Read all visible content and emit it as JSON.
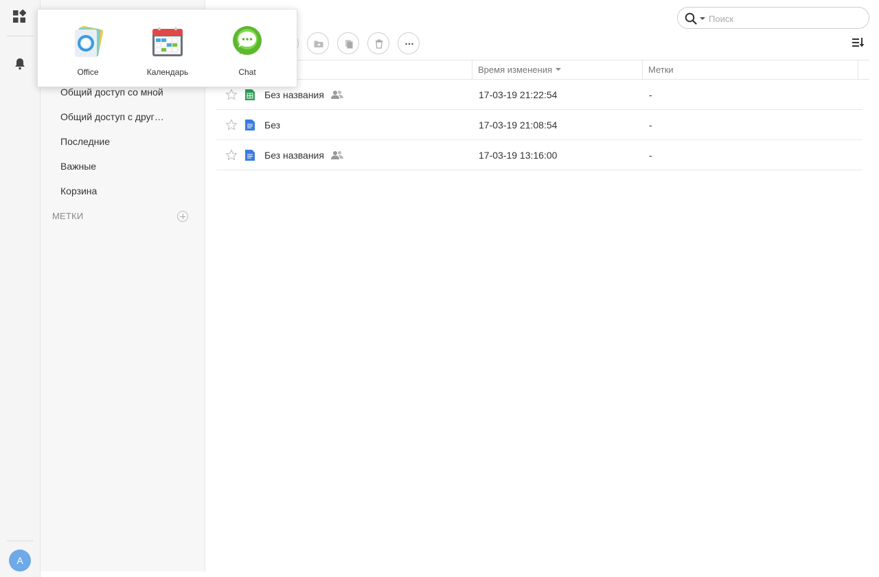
{
  "search": {
    "placeholder": "Поиск"
  },
  "rail": {
    "avatar_letter": "A"
  },
  "sidebar": {
    "items": [
      {
        "label": "Общий доступ со мной"
      },
      {
        "label": "Общий доступ с друг…"
      },
      {
        "label": "Последние"
      },
      {
        "label": "Важные"
      },
      {
        "label": "Корзина"
      }
    ],
    "tags_label": "МЕТКИ"
  },
  "table": {
    "columns": {
      "modified": "Время изменения",
      "tags": "Метки"
    },
    "rows": [
      {
        "name": "Без названия",
        "type": "spreadsheet",
        "shared": true,
        "modified": "17-03-19 21:22:54",
        "tags": "-"
      },
      {
        "name": "Без",
        "type": "document",
        "shared": false,
        "modified": "17-03-19 21:08:54",
        "tags": "-"
      },
      {
        "name": "Без названия",
        "type": "document",
        "shared": true,
        "modified": "17-03-19 13:16:00",
        "tags": "-"
      }
    ]
  },
  "launcher": {
    "apps": [
      {
        "label": "Office",
        "icon": "office-icon"
      },
      {
        "label": "Календарь",
        "icon": "calendar-icon"
      },
      {
        "label": "Chat",
        "icon": "chat-icon"
      }
    ]
  },
  "colors": {
    "spreadsheet": "#2e9e57",
    "document": "#3b7ddd",
    "avatar": "#6ea9e8",
    "chat": "#5cb82e",
    "calendar_header": "#e04848"
  }
}
